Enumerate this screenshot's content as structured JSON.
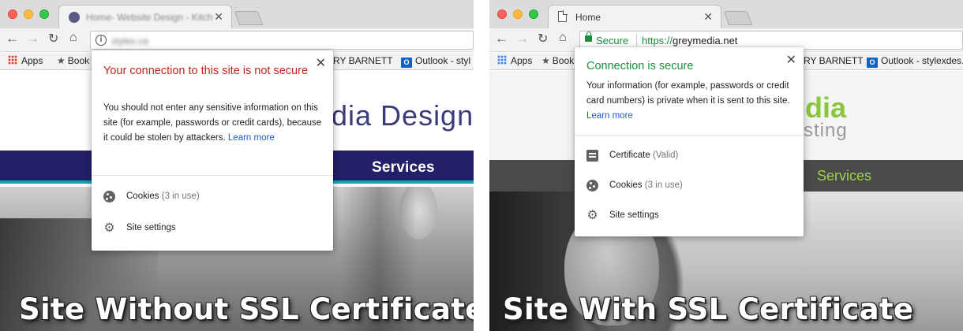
{
  "left": {
    "tab": {
      "title": "Home- Website Design - Kitch",
      "close": "✕"
    },
    "nav": {
      "back": "←",
      "forward": "→",
      "reload": "↻",
      "home": "⌂"
    },
    "omnibox": {
      "info_icon": "i",
      "url": "stylex.ca"
    },
    "bookmarks": {
      "apps": "Apps",
      "book": "Book",
      "partial": "RY BARNETT",
      "outlook_icon": "O",
      "outlook": "Outlook - styl"
    },
    "page": {
      "logo": "dia Design",
      "nav_services": "Services"
    },
    "popup": {
      "close": "✕",
      "heading": "Your connection to this site is not secure",
      "body": "You should not enter any sensitive information on this site (for example, passwords or credit cards), because it could be stolen by attackers.",
      "link": "Learn more",
      "cookies_label": "Cookies",
      "cookies_count": "(3 in use)",
      "site_settings": "Site settings"
    },
    "caption": "Site Without SSL Certificate"
  },
  "right": {
    "tab": {
      "title": "Home",
      "close": "✕"
    },
    "nav": {
      "back": "←",
      "forward": "→",
      "reload": "↻",
      "home": "⌂"
    },
    "omnibox": {
      "secure": "Secure",
      "url_scheme": "https://",
      "url_host": "greymedia.net"
    },
    "bookmarks": {
      "apps": "Apps",
      "book": "Book",
      "partial": "RY BARNETT",
      "outlook_icon": "O",
      "outlook": "Outlook - stylexdes."
    },
    "page": {
      "logo": "dia",
      "logo_sub": "sting",
      "nav_services": "Services"
    },
    "popup": {
      "close": "✕",
      "heading": "Connection is secure",
      "body": "Your information (for example, passwords or credit card numbers) is private when it is sent to this site.",
      "link": "Learn more",
      "certificate_label": "Certificate",
      "certificate_status": "(Valid)",
      "cookies_label": "Cookies",
      "cookies_count": "(3 in use)",
      "site_settings": "Site settings"
    },
    "caption": "Site With SSL Certificate"
  },
  "colors": {
    "warning_red": "#c5221f",
    "secure_green": "#1e8e3e",
    "link_blue": "#1a5dc4",
    "left_nav_bg": "#231f68",
    "right_nav_bg": "#4a4a4a",
    "right_accent_green": "#8cc63f"
  },
  "icons": {
    "info": "info-icon",
    "lock": "lock-icon",
    "cookie": "cookie-icon",
    "settings": "gear-icon",
    "certificate": "certificate-icon",
    "close": "close-icon"
  }
}
